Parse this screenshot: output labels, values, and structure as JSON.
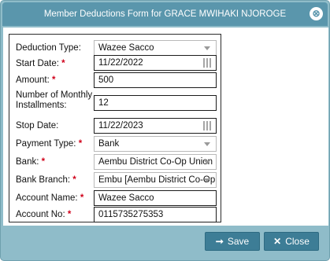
{
  "dialog": {
    "title": "Member Deductions Form for GRACE MWIHAKI NJOROGE",
    "close_symbol": "⊗"
  },
  "form": {
    "deduction_type": {
      "label": "Deduction Type:",
      "value": "Wazee Sacco"
    },
    "start_date": {
      "label": "Start Date:",
      "required": "*",
      "value": "11/22/2022"
    },
    "amount": {
      "label": "Amount:",
      "required": "*",
      "value": "500"
    },
    "installments": {
      "label_line1": "Number of Monthly",
      "label_line2": "Installments:",
      "value": "12"
    },
    "stop_date": {
      "label": "Stop Date:",
      "value": "11/22/2023"
    },
    "payment_type": {
      "label": "Payment Type:",
      "required": "*",
      "value": "Bank"
    },
    "bank": {
      "label": "Bank:",
      "required": "*",
      "value": "Aembu District Co-Op Union"
    },
    "bank_branch": {
      "label": "Bank Branch:",
      "required": "*",
      "value": "Embu [Aembu District Co-Op"
    },
    "account_name": {
      "label": "Account Name:",
      "required": "*",
      "value": "Wazee Sacco"
    },
    "account_no": {
      "label": "Account No:",
      "required": "*",
      "value": "0115735275353"
    }
  },
  "buttons": {
    "save_label": "Save",
    "close_label": "Close"
  },
  "icons": {
    "save": "login-arrow-icon",
    "close": "x-icon"
  },
  "colors": {
    "titlebar": "#5a96ac",
    "button": "#3d7d96",
    "frame": "#8fbcc9",
    "required": "#d0021b"
  }
}
